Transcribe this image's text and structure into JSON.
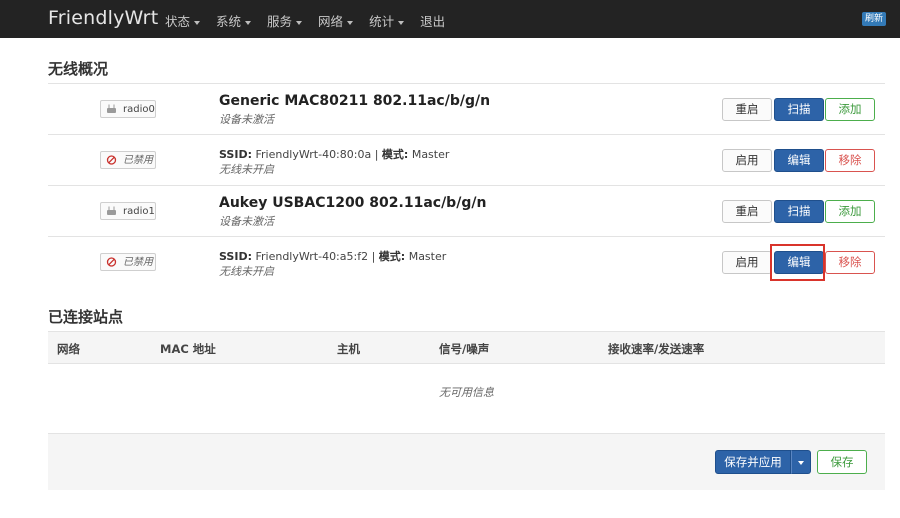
{
  "navbar": {
    "brand": "FriendlyWrt",
    "menu": [
      {
        "label": "状态",
        "dropdown": true
      },
      {
        "label": "系统",
        "dropdown": true
      },
      {
        "label": "服务",
        "dropdown": true
      },
      {
        "label": "网络",
        "dropdown": true
      },
      {
        "label": "统计",
        "dropdown": true
      },
      {
        "label": "退出",
        "dropdown": false
      }
    ],
    "refresh_label": "刷新"
  },
  "wireless": {
    "title": "无线概况",
    "rows": [
      {
        "kind": "device",
        "badge": "radio0",
        "name": "Generic MAC80211 802.11ac/b/g/n",
        "status": "设备未激活",
        "buttons": [
          "重启",
          "扫描",
          "添加"
        ]
      },
      {
        "kind": "network",
        "badge": "已禁用",
        "ssid_label": "SSID:",
        "ssid": "FriendlyWrt-40:80:0a",
        "mode_label": "模式:",
        "mode": "Master",
        "status": "无线未开启",
        "buttons": [
          "启用",
          "编辑",
          "移除"
        ]
      },
      {
        "kind": "device",
        "badge": "radio1",
        "name": "Aukey USBAC1200 802.11ac/b/g/n",
        "status": "设备未激活",
        "buttons": [
          "重启",
          "扫描",
          "添加"
        ]
      },
      {
        "kind": "network",
        "badge": "已禁用",
        "ssid_label": "SSID:",
        "ssid": "FriendlyWrt-40:a5:f2",
        "mode_label": "模式:",
        "mode": "Master",
        "status": "无线未开启",
        "buttons": [
          "启用",
          "编辑",
          "移除"
        ]
      }
    ]
  },
  "stations": {
    "title": "已连接站点",
    "columns": [
      "网络",
      "MAC 地址",
      "主机",
      "信号/噪声",
      "接收速率/发送速率"
    ],
    "empty_text": "无可用信息"
  },
  "footer": {
    "save_apply_label": "保存并应用",
    "save_label": "保存"
  },
  "colors": {
    "navbar_bg": "#232323",
    "primary": "#2d63a8",
    "success": "#4cae4c",
    "danger": "#d9534f",
    "highlight": "#d9342b"
  }
}
